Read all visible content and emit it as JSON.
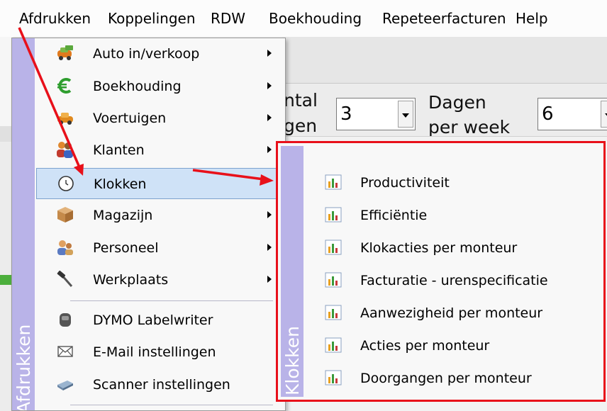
{
  "menubar": {
    "items": [
      "Afdrukken",
      "Koppelingen",
      "RDW",
      "Boekhouding",
      "Repeteerfacturen",
      "Help"
    ]
  },
  "background": {
    "label_aantal_1": "ntal",
    "label_aantal_2": "gen",
    "aantal_value": "3",
    "label_dagen_1": "Dagen",
    "label_dagen_2": "per week",
    "dagen_value": "6"
  },
  "menu": {
    "side_label": "Afdrukken",
    "items": [
      {
        "label": "Auto in/verkoop",
        "icon": "car-money-icon",
        "submenu": true
      },
      {
        "label": "Boekhouding",
        "icon": "euro-icon",
        "submenu": true
      },
      {
        "label": "Voertuigen",
        "icon": "car-icon",
        "submenu": true
      },
      {
        "label": "Klanten",
        "icon": "users-icon",
        "submenu": true
      },
      {
        "label": "Klokken",
        "icon": "clock-icon",
        "submenu": false,
        "highlighted": true
      },
      {
        "label": "Magazijn",
        "icon": "box-icon",
        "submenu": true
      },
      {
        "label": "Personeel",
        "icon": "personnel-icon",
        "submenu": true
      },
      {
        "label": "Werkplaats",
        "icon": "hammer-icon",
        "submenu": true
      },
      {
        "label": "DYMO Labelwriter",
        "icon": "label-printer-icon",
        "submenu": false
      },
      {
        "label": "E-Mail instellingen",
        "icon": "envelope-icon",
        "submenu": false
      },
      {
        "label": "Scanner instellingen",
        "icon": "scanner-icon",
        "submenu": false
      }
    ]
  },
  "submenu": {
    "side_label": "Klokken",
    "items": [
      {
        "label": "Productiviteit",
        "icon": "report-chart-icon"
      },
      {
        "label": "Efficiëntie",
        "icon": "report-chart-icon"
      },
      {
        "label": "Klokacties per monteur",
        "icon": "report-chart-icon"
      },
      {
        "label": "Facturatie - urenspecificatie",
        "icon": "report-chart-icon"
      },
      {
        "label": "Aanwezigheid per monteur",
        "icon": "report-chart-icon"
      },
      {
        "label": "Acties per monteur",
        "icon": "report-chart-icon"
      },
      {
        "label": "Doorgangen per monteur",
        "icon": "report-chart-icon"
      }
    ]
  },
  "colors": {
    "annotation_red": "#e8101a",
    "menu_sidebar": "#b9b3e8",
    "highlight": "#cfe2f7"
  }
}
